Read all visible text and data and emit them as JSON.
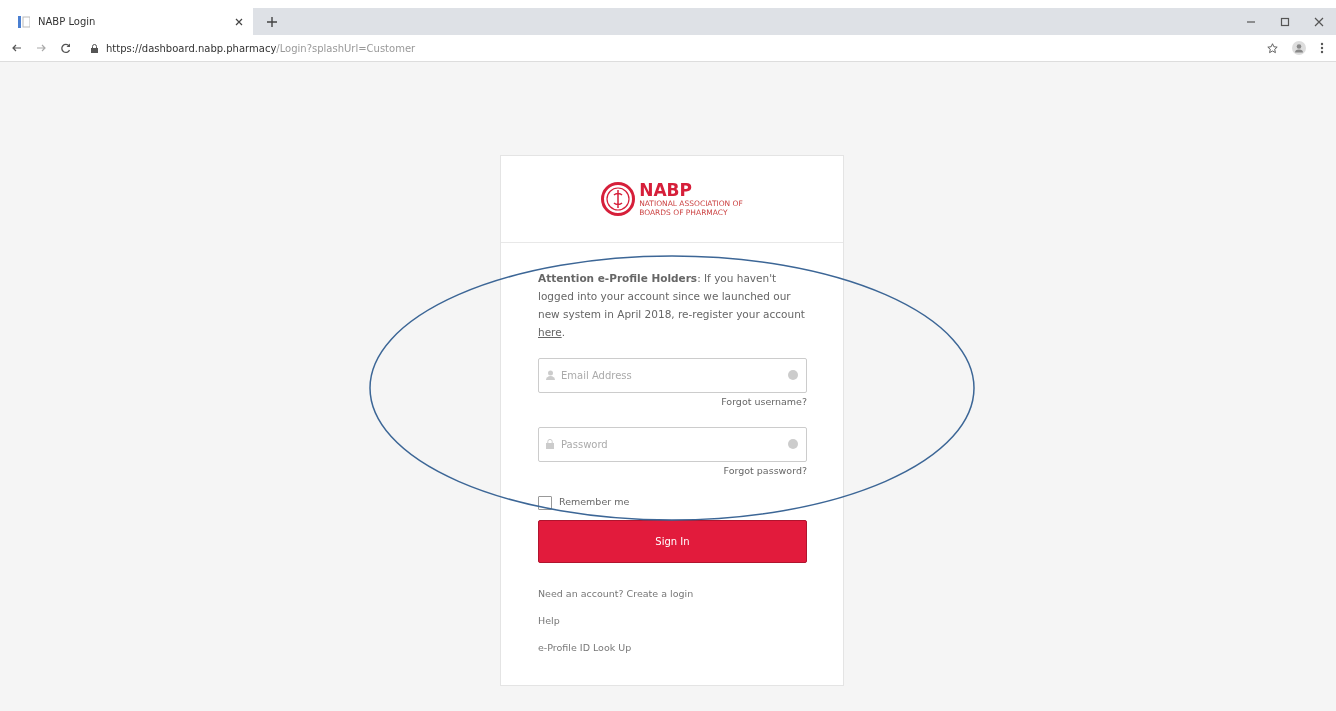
{
  "browser": {
    "tabs": [
      {
        "title": "NABP Login",
        "selected": true
      }
    ],
    "url_host": "https://dashboard.nabp.pharmacy",
    "url_path": "/Login?splashUrl=Customer"
  },
  "logo": {
    "name": "NABP",
    "subtitle_lines": [
      "NATIONAL ASSOCIATION OF",
      "BOARDS OF PHARMACY"
    ]
  },
  "notice": "**Attention e-Profile Holders**: If you haven't logged into your account since we launched our new system in April 2018, re-register your account ",
  "notice_link": "here",
  "notice_end": ".",
  "fields": [
    {
      "kind": "email",
      "placeholder": "Email Address",
      "link": "Forgot username?"
    },
    {
      "kind": "password",
      "placeholder": "Password",
      "link": "Forgot password?"
    }
  ],
  "remember": {
    "label": "Remember me",
    "checked": false
  },
  "sign_in": "Sign In",
  "links": [
    "Need an account? Create a login",
    "Help",
    "e-Profile ID Look Up"
  ],
  "annotation": {
    "kind": "ellipse"
  }
}
